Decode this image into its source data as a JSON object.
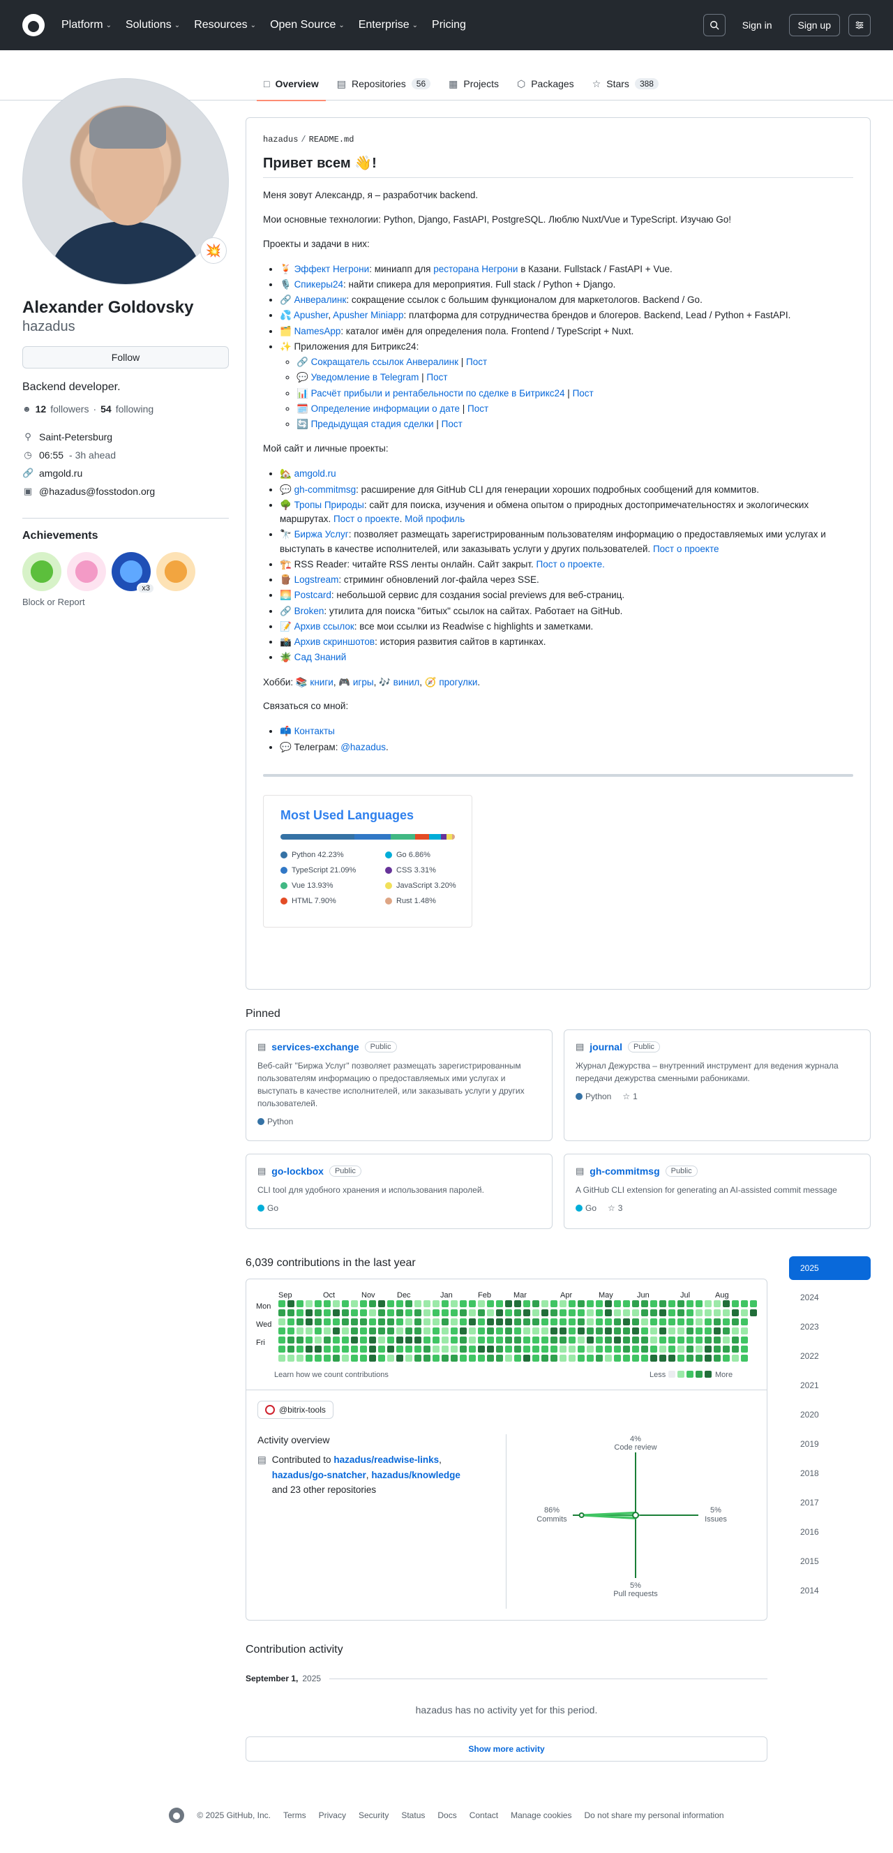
{
  "header": {
    "nav": [
      {
        "label": "Platform",
        "caret": true
      },
      {
        "label": "Solutions",
        "caret": true
      },
      {
        "label": "Resources",
        "caret": true
      },
      {
        "label": "Open Source",
        "caret": true
      },
      {
        "label": "Enterprise",
        "caret": true
      },
      {
        "label": "Pricing",
        "caret": false
      }
    ],
    "sign_in": "Sign in",
    "sign_up": "Sign up"
  },
  "tabs": [
    {
      "label": "Overview",
      "icon": "book-icon",
      "glyph": "□",
      "count": ""
    },
    {
      "label": "Repositories",
      "icon": "repo-icon",
      "glyph": "▤",
      "count": "56"
    },
    {
      "label": "Projects",
      "icon": "table-icon",
      "glyph": "▦",
      "count": ""
    },
    {
      "label": "Packages",
      "icon": "package-icon",
      "glyph": "⬡",
      "count": ""
    },
    {
      "label": "Stars",
      "icon": "star-icon",
      "glyph": "☆",
      "count": "388"
    }
  ],
  "profile": {
    "status_emoji": "💥",
    "fullname": "Alexander Goldovsky",
    "username": "hazadus",
    "follow": "Follow",
    "bio": "Backend developer.",
    "followers_count": "12",
    "followers_label": "followers",
    "following_count": "54",
    "following_label": "following",
    "location": "Saint-Petersburg",
    "time": "06:55",
    "time_note": "- 3h ahead",
    "website": "amgold.ru",
    "mastodon": "@hazadus@fosstodon.org",
    "achievements_title": "Achievements",
    "achievement_multiplier": "x3",
    "block_report": "Block or Report"
  },
  "readme": {
    "breadcrumb_user": "hazadus",
    "breadcrumb_file": "README.md",
    "title": "Привет всем 👋!",
    "intro": "Меня зовут Александр, я – разработчик backend.",
    "tech": "Мои основные технологии: Python, Django, FastAPI, PostgreSQL. Люблю Nuxt/Vue и TypeScript. Изучаю Go!",
    "projects_heading": "Проекты и задачи в них:",
    "projects": [
      {
        "pre": "🍹 ",
        "links": [
          "Эффект Негрони"
        ],
        "text": ": миниапп для ",
        "link2": "ресторана Негрони",
        "rest": " в Казани. Fullstack / FastAPI + Vue."
      },
      {
        "pre": "🎙️ ",
        "links": [
          "Спикеры24"
        ],
        "text": ": найти спикера для мероприятия. Full stack / Python + Django.",
        "link2": "",
        "rest": ""
      },
      {
        "pre": "🔗 ",
        "links": [
          "Анвералинк"
        ],
        "text": ": сокращение ссылок с большим функционалом для маркетологов. Backend / Go.",
        "link2": "",
        "rest": ""
      },
      {
        "pre": "💦 ",
        "links": [
          "Apusher",
          "Apusher Miniapp"
        ],
        "text": ": платформа для сотрудничества брендов и блогеров. Backend, Lead / Python + FastAPI.",
        "link2": "",
        "rest": ""
      },
      {
        "pre": "🗂️ ",
        "links": [
          "NamesApp"
        ],
        "text": ": каталог имён для определения пола. Frontend / TypeScript + Nuxt.",
        "link2": "",
        "rest": ""
      }
    ],
    "bitrix_heading": "✨ Приложения для Битрикс24:",
    "bitrix": [
      {
        "pre": "🔗 ",
        "name": "Сокращатель ссылок Анвералинк",
        "post": "Пост"
      },
      {
        "pre": "💬 ",
        "name": "Уведомление в Telegram",
        "post": "Пост"
      },
      {
        "pre": "📊 ",
        "name": "Расчёт прибыли и рентабельности по сделке в Битрикс24",
        "post": "Пост"
      },
      {
        "pre": "🗓️ ",
        "name": "Определение информации о дате",
        "post": "Пост"
      },
      {
        "pre": "🔄 ",
        "name": "Предыдущая стадия сделки",
        "post": "Пост"
      }
    ],
    "personal_heading": "Мой сайт и личные проекты:",
    "personal": [
      {
        "pre": "🏡 ",
        "link": "amgold.ru",
        "text": "",
        "extra": []
      },
      {
        "pre": "💬 ",
        "link": "gh-commitmsg",
        "text": ": расширение для GitHub CLI для генерации хороших подробных сообщений для коммитов.",
        "extra": []
      },
      {
        "pre": "🌳 ",
        "link": "Тропы Природы",
        "text": ": сайт для поиска, изучения и обмена опытом о природных достопримечательностях и экологических маршрутах. ",
        "extra": [
          "Пост о проекте",
          "Мой профиль"
        ]
      },
      {
        "pre": "🔭 ",
        "link": "Биржа Услуг",
        "text": ": позволяет размещать зарегистрированным пользователям информацию о предоставляемых ими услугах и выступать в качестве исполнителей, или заказывать услуги у других пользователей. ",
        "extra": [
          "Пост о проекте"
        ]
      },
      {
        "pre": "🏗️ ",
        "link": "",
        "text": "RSS Reader: читайте RSS ленты онлайн. Сайт закрыт. ",
        "extra": [
          "Пост о проекте."
        ]
      },
      {
        "pre": "🪵 ",
        "link": "Logstream",
        "text": ": стриминг обновлений лог-файла через SSE.",
        "extra": []
      },
      {
        "pre": "🌅 ",
        "link": "Postcard",
        "text": ": небольшой сервис для создания social previews для веб-страниц.",
        "extra": []
      },
      {
        "pre": "🔗 ",
        "link": "Broken",
        "text": ": утилита для поиска \"битых\" ссылок на сайтах. Работает на GitHub.",
        "extra": []
      },
      {
        "pre": "📝 ",
        "link": "Архив ссылок",
        "text": ": все мои ссылки из Readwise с highlights и заметками.",
        "extra": []
      },
      {
        "pre": "📸 ",
        "link": "Архив скриншотов",
        "text": ": история развития сайтов в картинках.",
        "extra": []
      },
      {
        "pre": "🪴 ",
        "link": "Сад Знаний",
        "text": "",
        "extra": []
      }
    ],
    "hobby_prefix": "Хобби: ",
    "hobbies": [
      "📚 книги",
      "🎮 игры",
      "🎶 винил",
      "🧭 прогулки"
    ],
    "contact_heading": "Связаться со мной:",
    "contacts_link": "Контакты",
    "telegram_label": "Телеграм: ",
    "telegram_handle": "@hazadus"
  },
  "languages": {
    "title": "Most Used Languages",
    "items": [
      {
        "name": "Python",
        "pct": 42.23,
        "label": "Python 42.23%",
        "color": "#3572A5"
      },
      {
        "name": "Go",
        "pct": 6.86,
        "label": "Go 6.86%",
        "color": "#00ADD8"
      },
      {
        "name": "TypeScript",
        "pct": 21.09,
        "label": "TypeScript 21.09%",
        "color": "#3178c6"
      },
      {
        "name": "CSS",
        "pct": 3.31,
        "label": "CSS 3.31%",
        "color": "#663399"
      },
      {
        "name": "Vue",
        "pct": 13.93,
        "label": "Vue 13.93%",
        "color": "#41b883"
      },
      {
        "name": "JavaScript",
        "pct": 3.2,
        "label": "JavaScript 3.20%",
        "color": "#f1e05a"
      },
      {
        "name": "HTML",
        "pct": 7.9,
        "label": "HTML 7.90%",
        "color": "#e34c26"
      },
      {
        "name": "Rust",
        "pct": 1.48,
        "label": "Rust 1.48%",
        "color": "#dea584"
      }
    ]
  },
  "pinned": {
    "title": "Pinned",
    "items": [
      {
        "name": "services-exchange",
        "visibility": "Public",
        "desc": "Веб-сайт \"Биржа Услуг\" позволяет размещать зарегистрированным пользователям информацию о предоставляемых ими услугах и выступать в качестве исполнителей, или заказывать услуги у других пользователей.",
        "lang": "Python",
        "lang_color": "#3572A5",
        "stars": ""
      },
      {
        "name": "journal",
        "visibility": "Public",
        "desc": "Журнал Дежурства – внутренний инструмент для ведения журнала передачи дежурства сменными рабониками.",
        "lang": "Python",
        "lang_color": "#3572A5",
        "stars": "1"
      },
      {
        "name": "go-lockbox",
        "visibility": "Public",
        "desc": "CLI tool для удобного хранения и использования паролей.",
        "lang": "Go",
        "lang_color": "#00ADD8",
        "stars": ""
      },
      {
        "name": "gh-commitmsg",
        "visibility": "Public",
        "desc": "A GitHub CLI extension for generating an AI-assisted commit message",
        "lang": "Go",
        "lang_color": "#00ADD8",
        "stars": "3"
      }
    ]
  },
  "contributions": {
    "title": "6,039 contributions in the last year",
    "months": [
      "Sep",
      "Oct",
      "Nov",
      "Dec",
      "Jan",
      "Feb",
      "Mar",
      "Apr",
      "May",
      "Jun",
      "Jul",
      "Aug"
    ],
    "days": [
      "Mon",
      "Wed",
      "Fri"
    ],
    "learn": "Learn how we count contributions",
    "less": "Less",
    "more": "More",
    "levels": [
      "#ebedf0",
      "#9be9a8",
      "#40c463",
      "#30a14e",
      "#216e39"
    ],
    "years": [
      "2025",
      "2024",
      "2023",
      "2022",
      "2021",
      "2020",
      "2019",
      "2018",
      "2017",
      "2016",
      "2015",
      "2014"
    ]
  },
  "activity": {
    "org": "@bitrix-tools",
    "overview_title": "Activity overview",
    "contributed_to": "Contributed to",
    "repo1": "hazadus/readwise-links",
    "repo2": "hazadus/go-snatcher",
    "repo3": "hazadus/knowledge",
    "others": "and 23 other repositories",
    "axes": {
      "code_review_pct": "4%",
      "code_review": "Code review",
      "commits_pct": "86%",
      "commits": "Commits",
      "issues_pct": "5%",
      "issues": "Issues",
      "pr_pct": "5%",
      "pr": "Pull requests"
    },
    "values": {
      "code_review": 4,
      "commits": 86,
      "issues": 5,
      "pull_requests": 5
    }
  },
  "contribution_activity": {
    "title": "Contribution activity",
    "month": "September 1,",
    "year": "2025",
    "empty": "hazadus has no activity yet for this period.",
    "show_more": "Show more activity"
  },
  "footer": {
    "copyright": "© 2025 GitHub, Inc.",
    "links": [
      "Terms",
      "Privacy",
      "Security",
      "Status",
      "Docs",
      "Contact",
      "Manage cookies",
      "Do not share my personal information"
    ]
  }
}
